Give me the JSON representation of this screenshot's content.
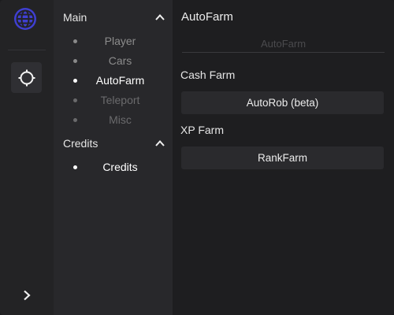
{
  "sidebar": {
    "sections": [
      {
        "title": "Main",
        "items": [
          {
            "label": "Player"
          },
          {
            "label": "Cars"
          },
          {
            "label": "AutoFarm"
          },
          {
            "label": "Teleport"
          },
          {
            "label": "Misc"
          }
        ]
      },
      {
        "title": "Credits",
        "items": [
          {
            "label": "Credits"
          }
        ]
      }
    ]
  },
  "main": {
    "title": "AutoFarm",
    "subtab_label": "AutoFarm",
    "groups": [
      {
        "label": "Cash Farm",
        "button_label": "AutoRob (beta)"
      },
      {
        "label": "XP Farm",
        "button_label": "RankFarm"
      }
    ]
  },
  "colors": {
    "logo": "#3f3fd1",
    "active_text": "#ffffff",
    "inactive_text": "#8c8c8c"
  },
  "icons": {
    "logo": "globe-icon",
    "rail_button": "crosshair-icon",
    "expand": "chevron-right-icon",
    "collapse": "chevron-up-icon"
  }
}
